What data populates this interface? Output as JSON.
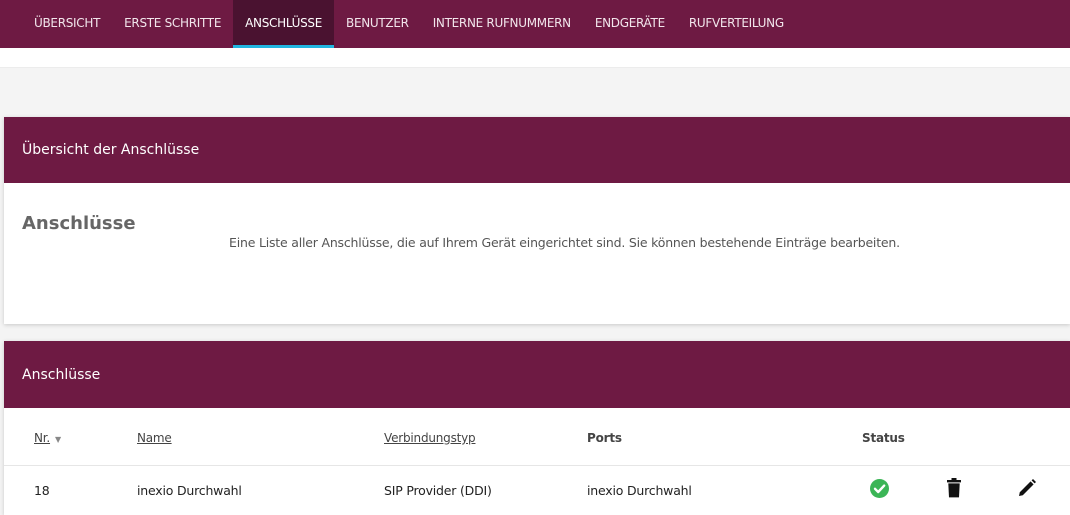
{
  "nav": {
    "tabs": [
      {
        "label": "ÜBERSICHT"
      },
      {
        "label": "ERSTE SCHRITTE"
      },
      {
        "label": "ANSCHLÜSSE",
        "active": true
      },
      {
        "label": "BENUTZER"
      },
      {
        "label": "INTERNE RUFNUMMERN"
      },
      {
        "label": "ENDGERÄTE"
      },
      {
        "label": "RUFVERTEILUNG"
      }
    ]
  },
  "overview_card": {
    "header": "Übersicht der Anschlüsse",
    "title": "Anschlüsse",
    "description": "Eine Liste aller Anschlüsse, die auf Ihrem Gerät eingerichtet sind. Sie können bestehende Einträge bearbeiten."
  },
  "list_card": {
    "header": "Anschlüsse",
    "columns": {
      "nr": "Nr.",
      "name": "Name",
      "type": "Verbindungstyp",
      "ports": "Ports",
      "status": "Status"
    },
    "rows": [
      {
        "nr": "18",
        "name": "inexio Durchwahl",
        "type": "SIP Provider (DDI)",
        "ports": "inexio Durchwahl",
        "status": "ok"
      }
    ]
  },
  "icons": {
    "status": "check-circle-icon",
    "delete": "trash-icon",
    "edit": "pencil-icon",
    "sort": "sort-down-icon"
  },
  "colors": {
    "brand": "#6e1a43",
    "brand_dark": "#4a1230",
    "active_tab_underline": "#21b6e0",
    "status_ok": "#3bb556"
  }
}
